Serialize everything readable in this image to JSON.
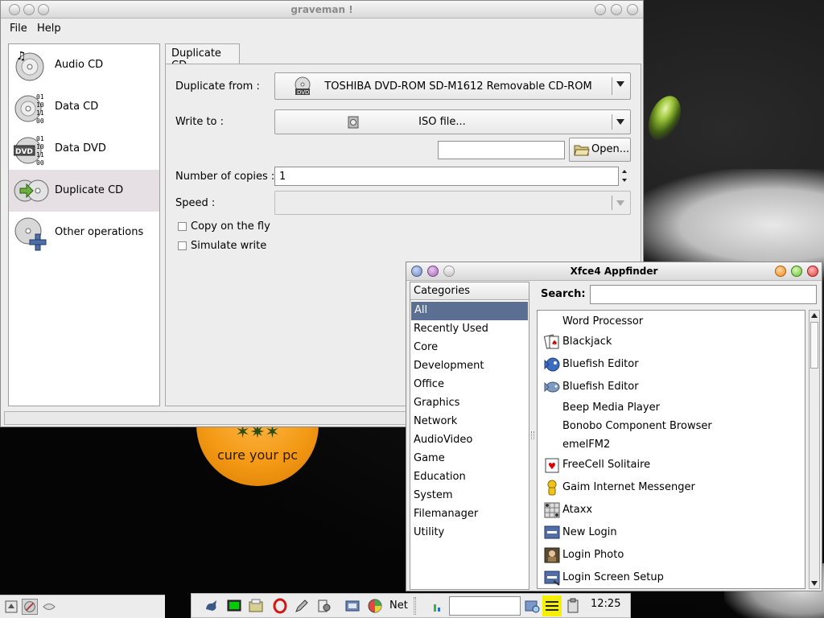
{
  "graveman": {
    "title": "graveman !",
    "menu": [
      "File",
      "Help"
    ],
    "operations": [
      {
        "label": "Audio CD",
        "icon": "audio-cd-icon",
        "selected": false
      },
      {
        "label": "Data CD",
        "icon": "data-cd-icon",
        "selected": false
      },
      {
        "label": "Data DVD",
        "icon": "data-dvd-icon",
        "selected": false
      },
      {
        "label": "Duplicate CD",
        "icon": "duplicate-cd-icon",
        "selected": true
      },
      {
        "label": "Other operations",
        "icon": "other-operations-icon",
        "selected": false
      }
    ],
    "tab": "Duplicate CD",
    "form": {
      "duplicate_from_label": "Duplicate from :",
      "duplicate_from_value": "TOSHIBA DVD-ROM SD-M1612 Removable CD-ROM",
      "write_to_label": "Write to :",
      "write_to_value": "ISO file...",
      "file_path_value": "",
      "open_button": "Open...",
      "copies_label": "Number of copies :",
      "copies_value": "1",
      "speed_label": "Speed :",
      "speed_value": "",
      "copy_on_fly_label": "Copy on the fly",
      "simulate_write_label": "Simulate write"
    },
    "icon_texts": {
      "dvd_badge": "DVD",
      "binary": "0 1\n1 0\n1 1\n0 0"
    }
  },
  "appfinder": {
    "title": "Xfce4 Appfinder",
    "categories_header": "Categories",
    "categories": [
      "All",
      "Recently Used",
      "Core",
      "Development",
      "Office",
      "Graphics",
      "Network",
      "AudioVideo",
      "Game",
      "Education",
      "System",
      "Filemanager",
      "Utility"
    ],
    "selected_category": "All",
    "search_label": "Search:",
    "search_value": "",
    "apps": [
      {
        "label": "Word Processor",
        "icon": ""
      },
      {
        "label": "Blackjack",
        "icon": "blackjack-icon"
      },
      {
        "label": "Bluefish Editor",
        "icon": "bluefish-icon"
      },
      {
        "label": "Bluefish Editor",
        "icon": "bluefish-gray-icon"
      },
      {
        "label": "Beep Media Player",
        "icon": ""
      },
      {
        "label": "Bonobo Component Browser",
        "icon": ""
      },
      {
        "label": "emelFM2",
        "icon": ""
      },
      {
        "label": "FreeCell Solitaire",
        "icon": "freecell-icon"
      },
      {
        "label": "Gaim Internet Messenger",
        "icon": "gaim-icon"
      },
      {
        "label": "Ataxx",
        "icon": "ataxx-icon"
      },
      {
        "label": "New Login",
        "icon": "new-login-icon"
      },
      {
        "label": "Login Photo",
        "icon": "login-photo-icon"
      },
      {
        "label": "Login Screen Setup",
        "icon": "login-screen-setup-icon"
      }
    ]
  },
  "desktop": {
    "logo_text": "cure your pc"
  },
  "taskbar": {
    "net_label": "Net",
    "clock": "12:25",
    "entry_value": ""
  }
}
